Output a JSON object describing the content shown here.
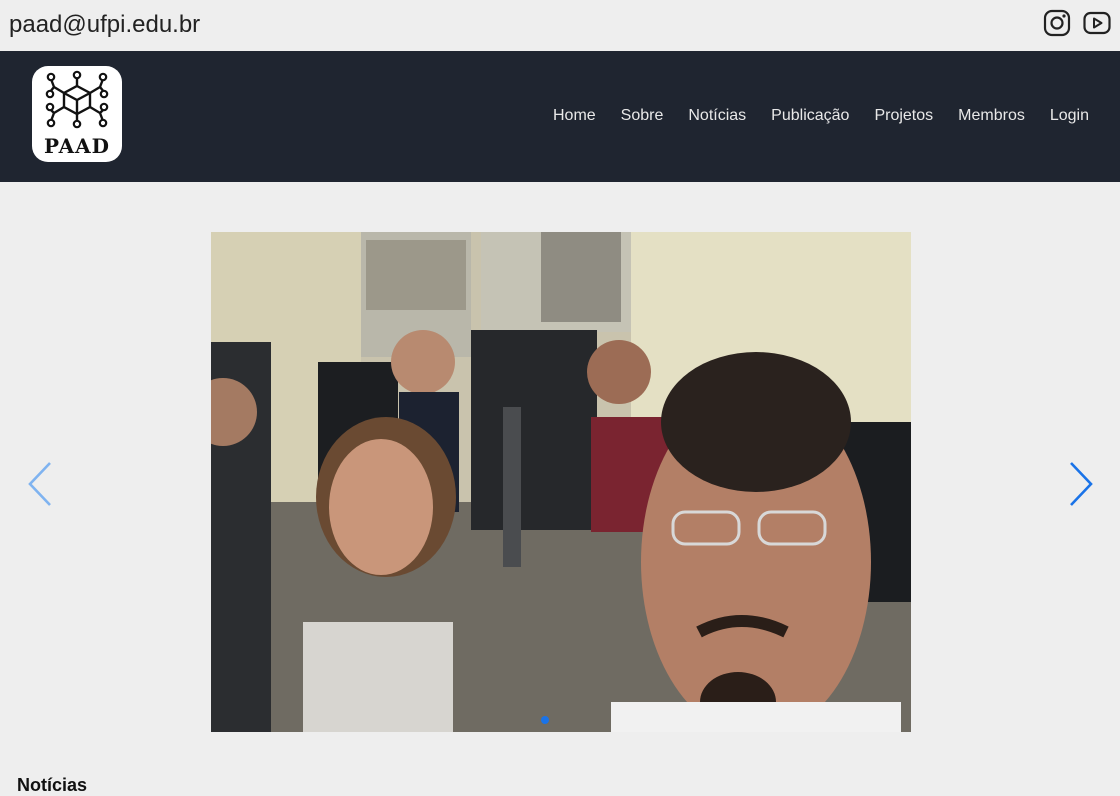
{
  "header": {
    "email": "paad@ufpi.edu.br",
    "social": [
      {
        "icon": "instagram-icon"
      },
      {
        "icon": "youtube-icon"
      }
    ]
  },
  "navbar": {
    "logo_text": "PAAD",
    "items": [
      "Home",
      "Sobre",
      "Notícias",
      "Publicação",
      "Projetos",
      "Membros",
      "Login"
    ],
    "background": "#1f2530"
  },
  "carousel": {
    "image_alt": "",
    "active_slide": 1,
    "slide_count": 1,
    "accent": "#1a73e8"
  },
  "sections": {
    "news_title": "Notícias"
  }
}
